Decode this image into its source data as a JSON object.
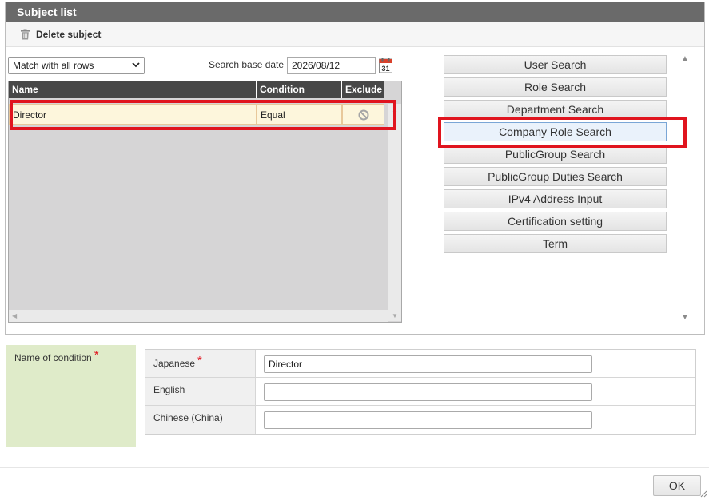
{
  "panel": {
    "title": "Subject list",
    "delete_label": "Delete subject"
  },
  "filter": {
    "match_selected": "Match with all rows",
    "search_base_date_label": "Search base date",
    "search_base_date_value": "2026/08/12"
  },
  "grid": {
    "columns": [
      "Name",
      "Condition",
      "Exclude"
    ],
    "rows": [
      {
        "name": "Director",
        "condition": "Equal",
        "exclude_icon": "prohibit-icon"
      }
    ]
  },
  "search_buttons": [
    "User Search",
    "Role Search",
    "Department Search",
    "Company Role Search",
    "PublicGroup Search",
    "PublicGroup Duties Search",
    "IPv4 Address Input",
    "Certification setting",
    "Term"
  ],
  "active_search_button": "Company Role Search",
  "condition_name": {
    "label": "Name of condition",
    "required_mark": "*",
    "languages": [
      {
        "label": "Japanese",
        "required": "*",
        "value": "Director"
      },
      {
        "label": "English",
        "required": "",
        "value": ""
      },
      {
        "label": "Chinese (China)",
        "required": "",
        "value": ""
      }
    ]
  },
  "footer": {
    "ok_label": "OK"
  },
  "colors": {
    "header_bg": "#6a6a6a",
    "grid_header_bg": "#474747",
    "grid_bg": "#d6d5d6",
    "selected_row_bg": "#fcf4d7",
    "highlight": "#e0141e",
    "condition_label_bg": "#dfebc9"
  }
}
